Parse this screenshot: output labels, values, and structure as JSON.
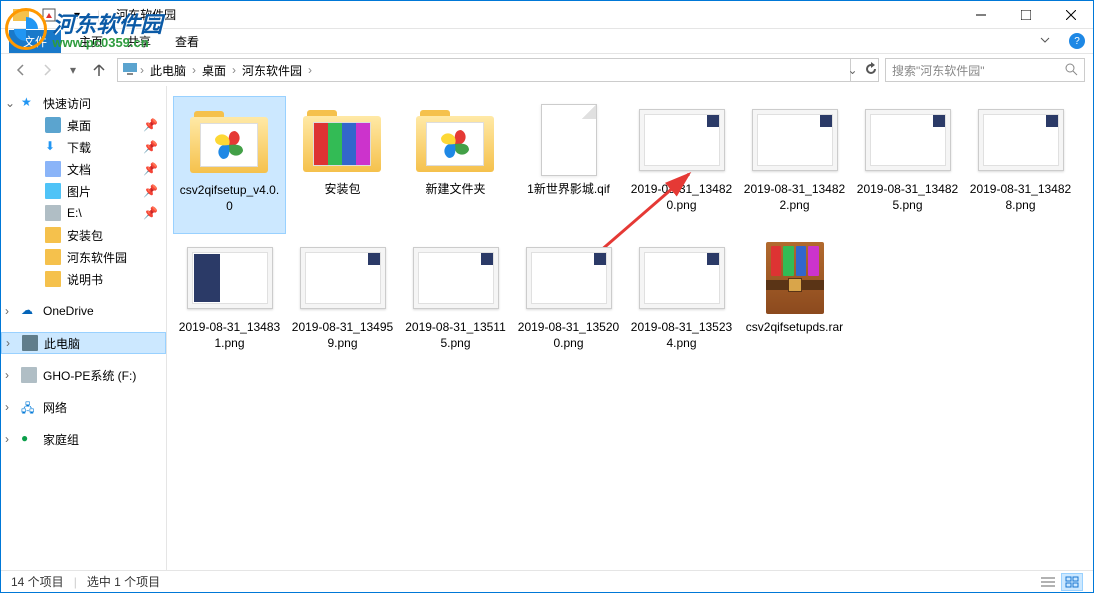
{
  "watermark": {
    "title": "河东软件园",
    "url": "www.pc0359.cn"
  },
  "window": {
    "title": "河东软件园"
  },
  "ribbon": {
    "file": "文件",
    "tabs": [
      "主页",
      "共享",
      "查看"
    ]
  },
  "breadcrumb": [
    "此电脑",
    "桌面",
    "河东软件园"
  ],
  "search": {
    "placeholder": "搜索\"河东软件园\""
  },
  "sidebar": {
    "quick": "快速访问",
    "items": [
      "桌面",
      "下载",
      "文档",
      "图片",
      "E:\\",
      "安装包",
      "河东软件园",
      "说明书"
    ],
    "onedrive": "OneDrive",
    "thispc": "此电脑",
    "ghodrive": "GHO-PE系统 (F:)",
    "network": "网络",
    "homegroup": "家庭组"
  },
  "files": [
    {
      "name": "csv2qifsetup_v4.0.0",
      "type": "folder-pinwheel",
      "selected": true
    },
    {
      "name": "安装包",
      "type": "folder-rar"
    },
    {
      "name": "新建文件夹",
      "type": "folder-pinwheel"
    },
    {
      "name": "1新世界影城.qif",
      "type": "blank"
    },
    {
      "name": "2019-08-31_134820.png",
      "type": "shot"
    },
    {
      "name": "2019-08-31_134822.png",
      "type": "shot"
    },
    {
      "name": "2019-08-31_134825.png",
      "type": "shot"
    },
    {
      "name": "2019-08-31_134828.png",
      "type": "shot"
    },
    {
      "name": "2019-08-31_134831.png",
      "type": "shot-dark"
    },
    {
      "name": "2019-08-31_134959.png",
      "type": "shot"
    },
    {
      "name": "2019-08-31_135115.png",
      "type": "shot"
    },
    {
      "name": "2019-08-31_135200.png",
      "type": "shot"
    },
    {
      "name": "2019-08-31_135234.png",
      "type": "shot"
    },
    {
      "name": "csv2qifsetupds.rar",
      "type": "rar"
    }
  ],
  "status": {
    "count": "14 个项目",
    "selected": "选中 1 个项目"
  }
}
